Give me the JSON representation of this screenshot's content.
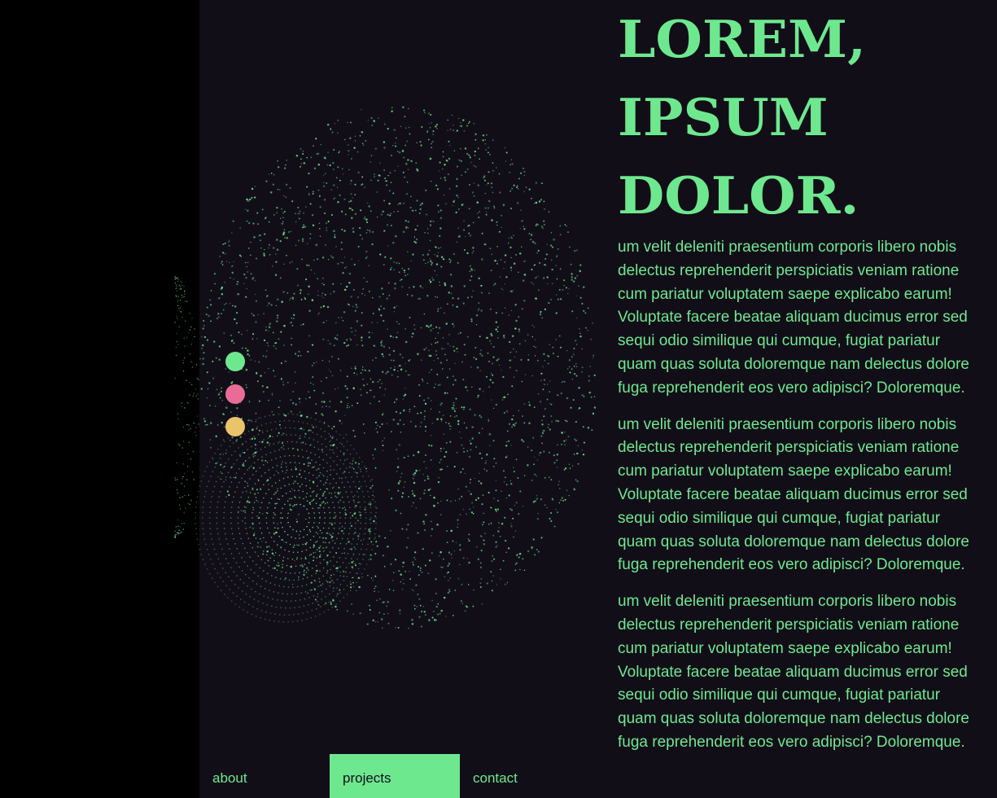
{
  "hero": {
    "lines": [
      "LOREM,",
      "IPSUM",
      "DOLOR."
    ]
  },
  "paragraphs": [
    "um velit deleniti praesentium corporis libero nobis delectus reprehenderit perspiciatis veniam ratione cum pariatur voluptatem saepe explicabo earum! Voluptate facere beatae aliquam ducimus error sed sequi odio similique qui cumque, fugiat pariatur quam quas soluta doloremque nam delectus dolore fuga reprehenderit eos vero adipisci? Doloremque.",
    "um velit deleniti praesentium corporis libero nobis delectus reprehenderit perspiciatis veniam ratione cum pariatur voluptatem saepe explicabo earum! Voluptate facere beatae aliquam ducimus error sed sequi odio similique qui cumque, fugiat pariatur quam quas soluta doloremque nam delectus dolore fuga reprehenderit eos vero adipisci? Doloremque.",
    "um velit deleniti praesentium corporis libero nobis delectus reprehenderit perspiciatis veniam ratione cum pariatur voluptatem saepe explicabo earum! Voluptate facere beatae aliquam ducimus error sed sequi odio similique qui cumque, fugiat pariatur quam quas soluta doloremque nam delectus dolore fuga reprehenderit eos vero adipisci? Doloremque."
  ],
  "theme_dots": [
    {
      "name": "green",
      "color": "#6ee88f"
    },
    {
      "name": "pink",
      "color": "#e86c96"
    },
    {
      "name": "yellow",
      "color": "#e9c46a"
    }
  ],
  "nav": {
    "items": [
      {
        "label": "about",
        "active": false
      },
      {
        "label": "projects",
        "active": true
      },
      {
        "label": "contact",
        "active": false
      }
    ]
  },
  "colors": {
    "accent": "#6ee88f",
    "panel_bg": "#120e18",
    "side_bg": "#000000"
  }
}
